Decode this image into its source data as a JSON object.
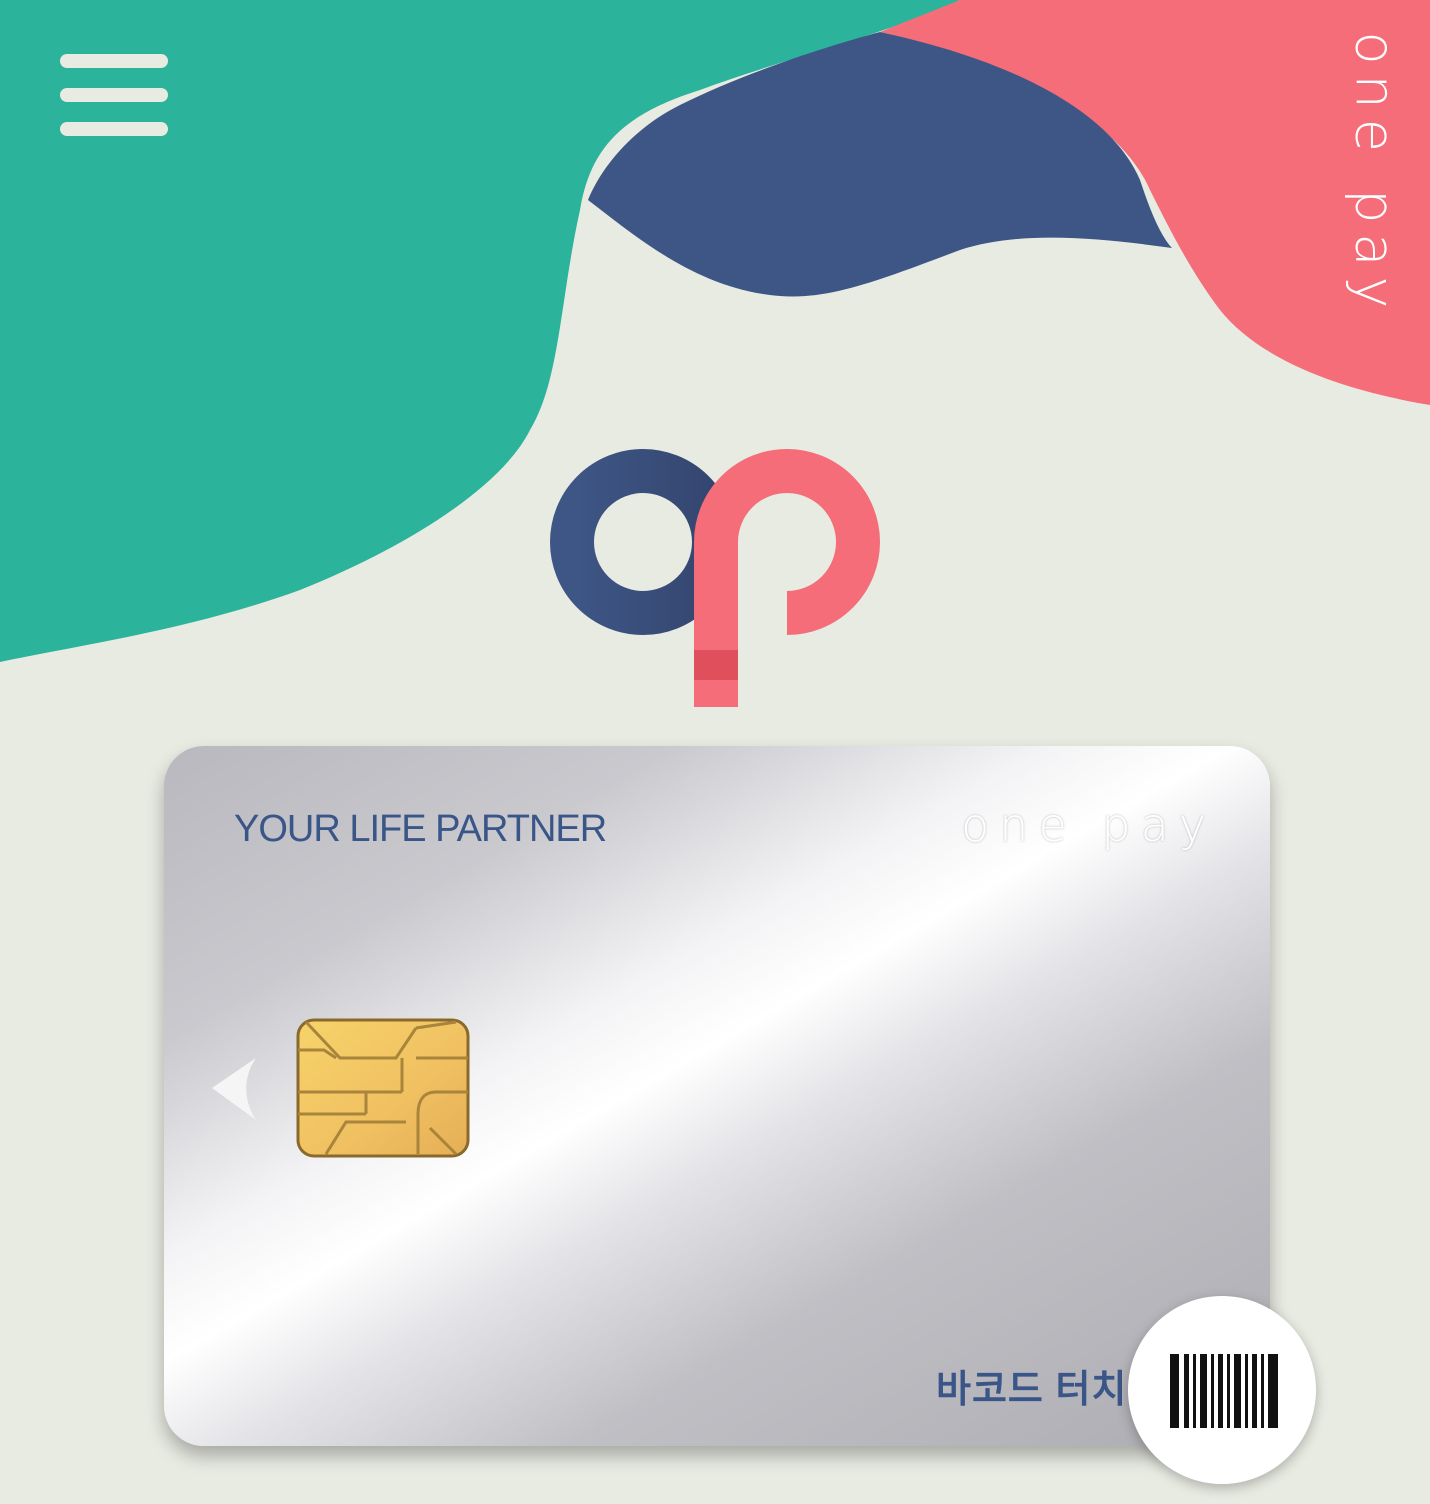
{
  "header": {
    "menu_icon": "hamburger-menu-icon",
    "brand_vertical": "one pay"
  },
  "logo": {
    "icon": "onepay-op-logo",
    "colors": {
      "navy": "#3e5686",
      "coral": "#f46d79",
      "red_band": "#e04f5c"
    }
  },
  "card": {
    "tagline": "YOUR LIFE PARTNER",
    "brand": "one pay",
    "prev_icon": "chevron-left-icon",
    "chip_icon": "chip-icon"
  },
  "barcode": {
    "label": "바코드 터치",
    "icon": "barcode-icon"
  },
  "colors": {
    "background": "#e8ebe2",
    "teal": "#2cb39b",
    "navy": "#3e5686",
    "coral": "#f46d79",
    "text_navy": "#3a5587"
  }
}
